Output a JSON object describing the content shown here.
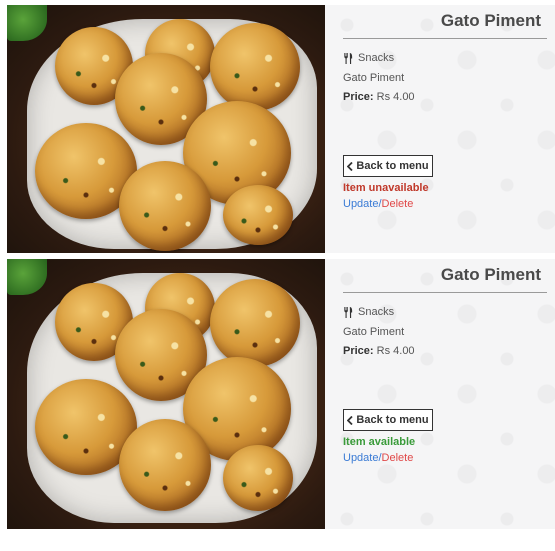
{
  "items": [
    {
      "title": "Gato Piment",
      "category": "Snacks",
      "description": "Gato Piment",
      "price_label": "Price:",
      "price_value": "Rs 4.00",
      "back_label": "Back to menu",
      "status": "Item unavailable",
      "status_color": "#c0392b",
      "update_label": "Update",
      "separator": "/",
      "delete_label": "Delete"
    },
    {
      "title": "Gato Piment",
      "category": "Snacks",
      "description": "Gato Piment",
      "price_label": "Price:",
      "price_value": "Rs 4.00",
      "back_label": "Back to menu",
      "status": "Item available",
      "status_color": "#3a9b3a",
      "update_label": "Update",
      "separator": "/",
      "delete_label": "Delete"
    }
  ],
  "icons": {
    "category": "fork-knife-icon",
    "back": "chevron-left-icon"
  }
}
